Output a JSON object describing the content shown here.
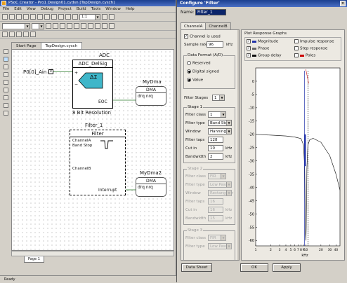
{
  "ide": {
    "title": "PSoC Creator - Pro1  Design01.cydsn  [TopDesign.cysch]",
    "menu": [
      "File",
      "Edit",
      "View",
      "Debug",
      "Project",
      "Build",
      "Tools",
      "Window",
      "Help"
    ],
    "zoom": "1:1",
    "tabs": [
      {
        "label": "Start Page"
      },
      {
        "label": "TopDesign.cysch"
      }
    ],
    "adc": {
      "title": "ADC",
      "subtitle": "ADC_DelSig",
      "delta_symbol": "ΔΣ",
      "pin_plus": "+",
      "pin_minus": "−",
      "eoc": "EOC",
      "resolution": "8 Bit Resolution"
    },
    "pin": {
      "label": "P0[0]_Ain"
    },
    "filter": {
      "title": "Filter_1",
      "subtitle": "Filter",
      "ch_a_line1": "ChannelA",
      "ch_a_line2": "Band Stop",
      "ch_b": "ChannelB",
      "interrupt": "Interrupt"
    },
    "dma1": {
      "title": "MyDma",
      "head": "DMA",
      "port": "drq  nrq"
    },
    "dma2": {
      "title": "MyDma2",
      "head": "DMA",
      "port": "drq  nrq"
    },
    "page_tab": "Page 1",
    "status": "Ready"
  },
  "dialog": {
    "title": "Configure 'Filter'",
    "name_label": "Name:",
    "name_value": "Filter_1",
    "close": "×",
    "tabs": [
      {
        "label": "ChannelA"
      },
      {
        "label": "ChannelB"
      }
    ],
    "chan_used": {
      "label": "Channel is used",
      "checked": true
    },
    "sample_rate": {
      "label": "Sample rate",
      "value": "96",
      "unit": "kHz"
    },
    "data_format_group": "Data Format (A/D)",
    "radios": [
      {
        "label": "Reserved",
        "on": false
      },
      {
        "label": "Digital signed",
        "on": true
      },
      {
        "label": "Value",
        "on": true
      }
    ],
    "filter_stages": {
      "label": "Filter Stages",
      "value": "1"
    },
    "stage1": {
      "group": "Stage 1",
      "filter_class": {
        "label": "Filter class",
        "value": "1"
      },
      "filter_type": {
        "label": "Filter type",
        "value": "Band Stop"
      },
      "window": {
        "label": "Window",
        "value": "Hanning"
      },
      "filter_taps": {
        "label": "Filter taps",
        "value": "128"
      },
      "cutoff": {
        "label": "Cut in",
        "value": "10",
        "unit": "kHz"
      },
      "bandwidth": {
        "label": "Bandwidth",
        "value": "2",
        "unit": "kHz"
      }
    },
    "stage2": {
      "group": "Stage 2",
      "filter_class": {
        "label": "Filter class",
        "value": "FIR"
      },
      "filter_type": {
        "label": "Filter type",
        "value": "Low Pass"
      },
      "window": {
        "label": "Window",
        "value": "Rectangular"
      },
      "filter_taps": {
        "label": "Filter taps",
        "value": "16"
      },
      "cutoff": {
        "label": "Cut in",
        "value": "16",
        "unit": "kHz"
      },
      "bandwidth": {
        "label": "Bandwidth",
        "value": "15",
        "unit": "kHz"
      }
    },
    "stage3": {
      "group": "Stage 3",
      "filter_class": {
        "label": "Filter class",
        "value": "FIR"
      },
      "filter_type": {
        "label": "Filter type",
        "value": "Low Pass"
      }
    },
    "graph": {
      "group": "Plot Response Graphs",
      "legend": [
        {
          "label": "Magnitude",
          "checked": true
        },
        {
          "label": "Phase",
          "checked": true
        },
        {
          "label": "Group delay",
          "checked": true
        },
        {
          "label": "Impulse response",
          "checked": false
        },
        {
          "label": "Step response",
          "checked": false
        },
        {
          "label": "Poles",
          "checked": false
        }
      ],
      "xaxis_label": "kHz",
      "colors": {
        "magnitude": "#2233aa",
        "phase": "#666666",
        "group_delay": "#111111",
        "accent": "#cc0000"
      }
    },
    "buttons": {
      "data_sheet": "Data Sheet",
      "ok": "OK",
      "apply": "Apply"
    }
  },
  "chart_data": {
    "type": "line",
    "xlabel": "kHz",
    "x_ticks": [
      "1",
      "2",
      "3",
      "4",
      "5",
      "6",
      "7",
      "8",
      "9",
      "10",
      "20",
      "30",
      "40"
    ],
    "y_ticks": [
      "0",
      "-5",
      "-10",
      "-15",
      "-20",
      "-25",
      "-30",
      "-35",
      "-40",
      "-45",
      "-50",
      "-55",
      "-60"
    ],
    "xlim": [
      1,
      48
    ],
    "ylim": [
      -62,
      5
    ],
    "log_x": true,
    "series": [
      {
        "name": "Magnitude",
        "x": [
          1,
          2,
          4,
          6,
          8,
          9,
          9.5,
          9.8,
          10,
          10.2,
          10.5,
          11,
          12,
          14,
          20,
          30,
          40,
          48
        ],
        "y": [
          -20,
          -20.3,
          -20.6,
          -21,
          -21.6,
          -24,
          -33,
          -55,
          -60,
          -55,
          -33,
          -24,
          -22,
          -21.5,
          -23,
          -28,
          -35,
          -41
        ]
      }
    ]
  }
}
